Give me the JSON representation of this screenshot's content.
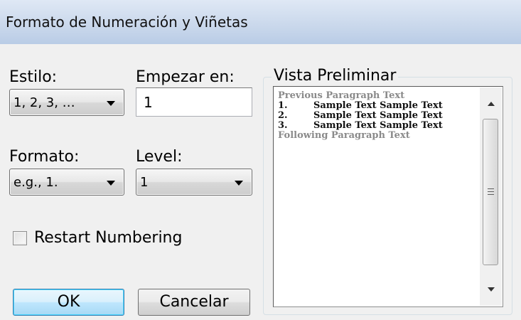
{
  "window": {
    "title": "Formato de Numeración y Viñetas"
  },
  "estilo": {
    "label": "Estilo:",
    "value": "1, 2, 3, …"
  },
  "empezar": {
    "label": "Empezar en:",
    "value": "1"
  },
  "formato": {
    "label": "Formato:",
    "value": "e.g., 1."
  },
  "level": {
    "label": "Level:",
    "value": "1"
  },
  "restart": {
    "label": "Restart Numbering",
    "checked": false
  },
  "buttons": {
    "ok": "OK",
    "cancel": "Cancelar"
  },
  "preview": {
    "label": "Vista Preliminar",
    "previous": "Previous Paragraph Text",
    "items": [
      {
        "num": "1.",
        "text": "Sample Text Sample Text"
      },
      {
        "num": "2.",
        "text": "Sample Text Sample Text"
      },
      {
        "num": "3.",
        "text": "Sample Text Sample Text"
      }
    ],
    "following": "Following Paragraph Text"
  },
  "colors": {
    "titlebar": "#cbd9ec",
    "default_button_border": "#3c7fb1",
    "grey_text": "#8a8a8a"
  }
}
